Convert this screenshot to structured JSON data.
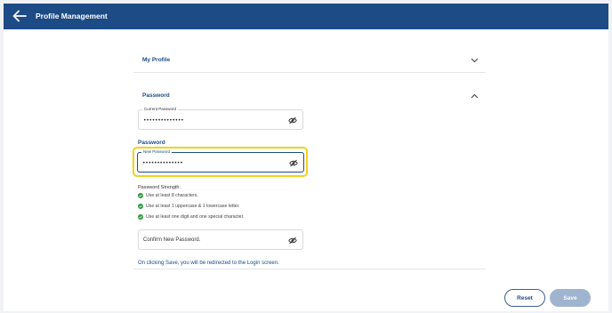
{
  "header": {
    "title": "Profile Management",
    "back_icon": "arrow-left-icon"
  },
  "sections": {
    "my_profile": {
      "label": "My Profile",
      "expanded": false
    },
    "password": {
      "label": "Password",
      "expanded": true
    }
  },
  "fields": {
    "current_password": {
      "label": "Current Password",
      "value": "••••••••••••••"
    },
    "password_heading": "Password",
    "new_password": {
      "label": "New Password",
      "value": "••••••••••••••"
    },
    "confirm_password": {
      "placeholder": "Confirm New Password."
    }
  },
  "strength": {
    "title": "Password Strength:",
    "rules": [
      "Use at least 8 characters.",
      "Use at least 1 uppercase & 1 lowercase letter.",
      "Use at least one digit and one special character."
    ]
  },
  "note": "On clicking Save, you will be redirected to the Login screen.",
  "buttons": {
    "reset": "Reset",
    "save": "Save"
  },
  "colors": {
    "brand": "#1d4b86",
    "focus_highlight": "#f0d31c",
    "success": "#2f9a3d",
    "save_disabled": "#9fb4cf"
  }
}
